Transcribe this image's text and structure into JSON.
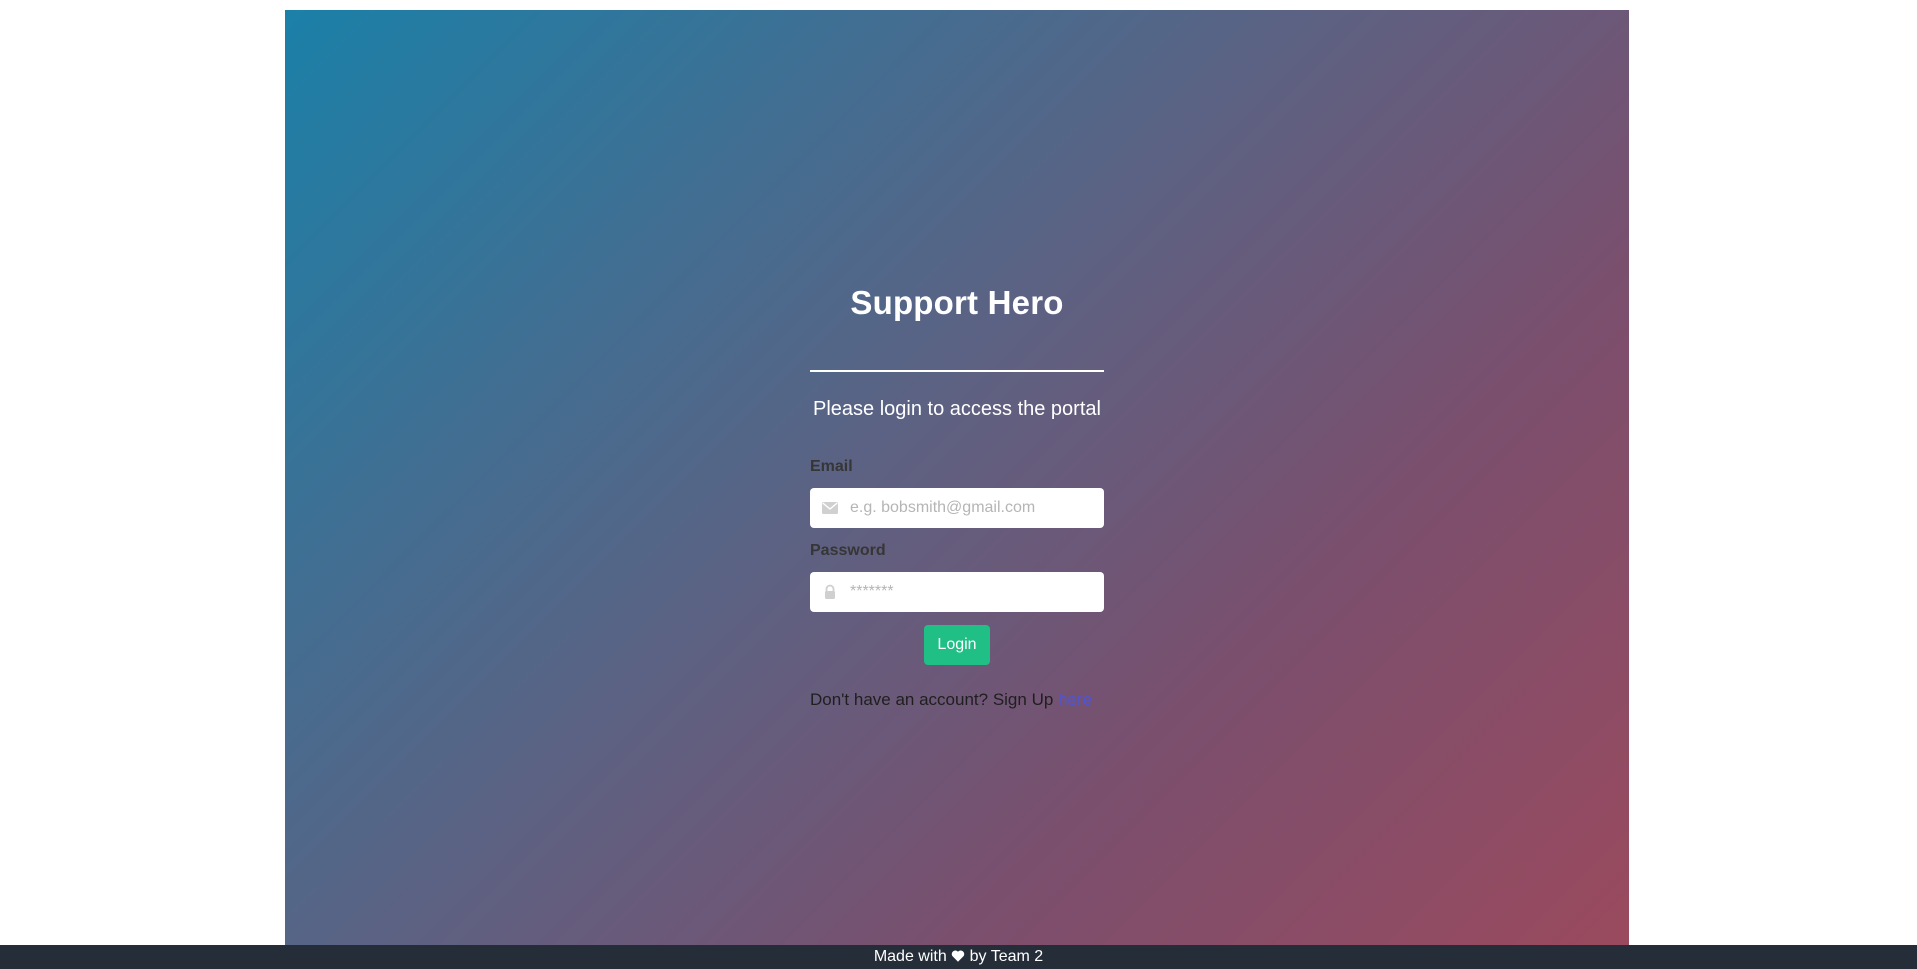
{
  "app": {
    "title": "Support Hero",
    "subtitle": "Please login to access the portal"
  },
  "form": {
    "email": {
      "label": "Email",
      "placeholder": "e.g. bobsmith@gmail.com",
      "value": "",
      "icon": "envelope-icon"
    },
    "password": {
      "label": "Password",
      "placeholder": "*******",
      "value": "",
      "icon": "lock-icon"
    },
    "login_label": "Login"
  },
  "signup": {
    "prompt": "Don't have an account? Sign Up ",
    "link_text": "here"
  },
  "footer": {
    "prefix": "Made with ",
    "icon": "heart-icon",
    "suffix": " by Team 2"
  },
  "colors": {
    "gradient_start": "#1b80a8",
    "gradient_end": "#9a4a5e",
    "login_button": "#1fbf85",
    "link": "#4f55d6",
    "footer_bg": "#252e38"
  }
}
